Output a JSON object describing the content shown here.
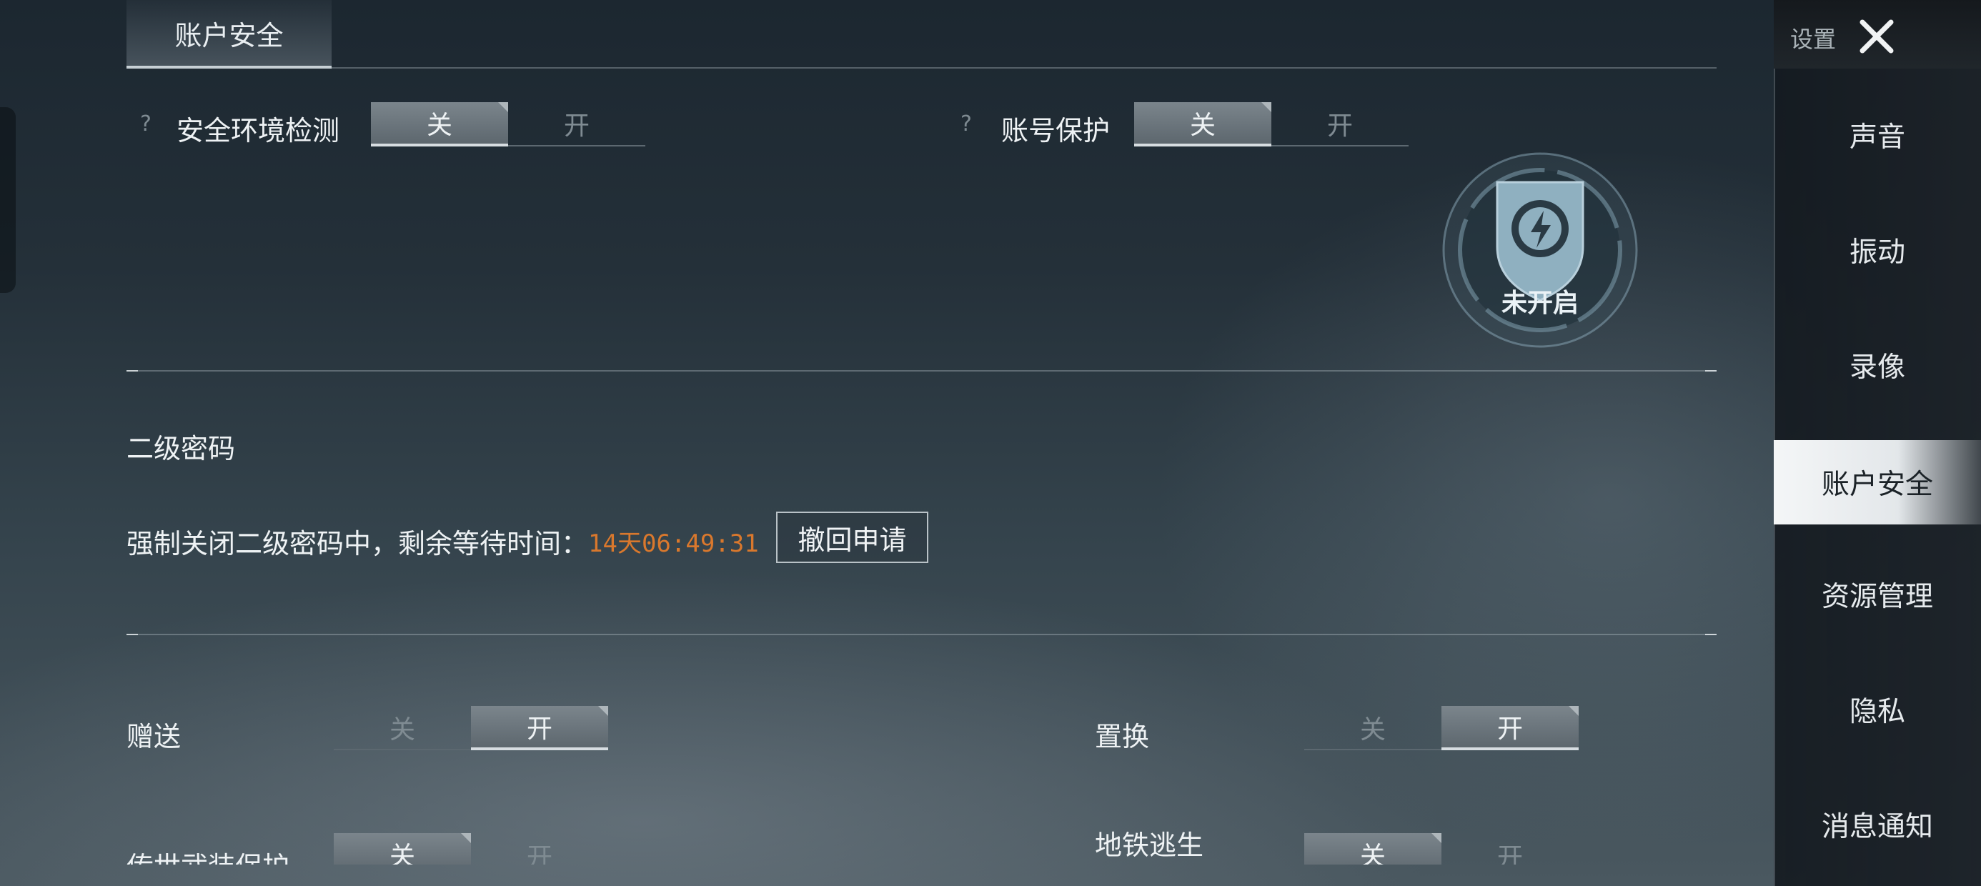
{
  "tabs": [
    {
      "label": "账户安全",
      "active": true
    }
  ],
  "security_env": {
    "label": "安全环境检测",
    "help": "?",
    "off_label": "关",
    "on_label": "开",
    "state": "off"
  },
  "account_protect": {
    "label": "账号保护",
    "help": "?",
    "off_label": "关",
    "on_label": "开",
    "state": "off"
  },
  "badge": {
    "status_text": "未开启",
    "icon": "shield-lightning-icon"
  },
  "second_password": {
    "title": "二级密码",
    "status_text": "强制关闭二级密码中，剩余等待时间：",
    "countdown": "14天06:49:31",
    "revoke_button": "撤回申请"
  },
  "gift": {
    "label": "赠送",
    "off_label": "关",
    "on_label": "开",
    "state": "on"
  },
  "exchange": {
    "label": "置换",
    "off_label": "关",
    "on_label": "开",
    "state": "on"
  },
  "legendary_protect": {
    "label": "传世武装保护",
    "off_label": "关",
    "on_label": "开",
    "state": "off"
  },
  "metro_escape": {
    "label": "地铁逃生",
    "off_label": "关",
    "on_label": "开",
    "state": "off"
  },
  "sidebar": {
    "title": "设置",
    "close_icon": "close-icon",
    "items": [
      {
        "label": "声音",
        "active": false
      },
      {
        "label": "振动",
        "active": false
      },
      {
        "label": "录像",
        "active": false
      },
      {
        "label": "账户安全",
        "active": true
      },
      {
        "label": "资源管理",
        "active": false
      },
      {
        "label": "隐私",
        "active": false
      },
      {
        "label": "消息通知",
        "active": false
      }
    ]
  },
  "colors": {
    "countdown": "#d9782d",
    "accent": "#d7dde1",
    "badge": "#8fb0c0"
  }
}
